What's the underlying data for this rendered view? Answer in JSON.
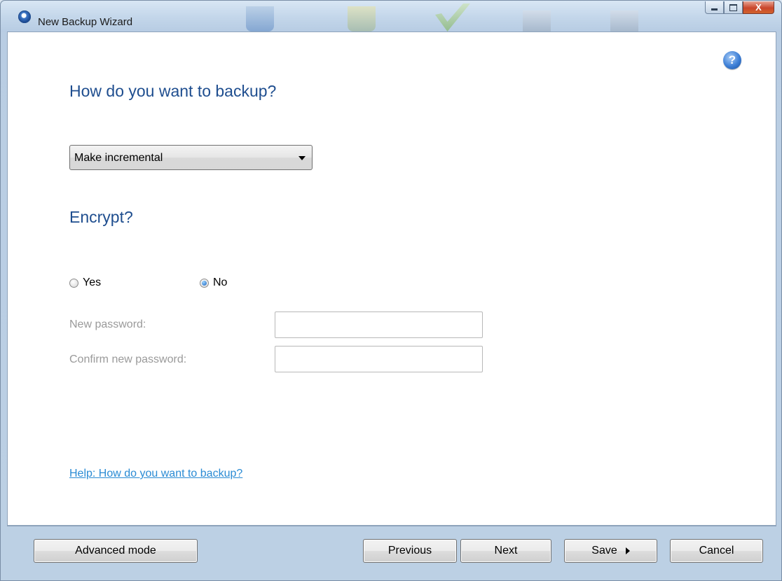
{
  "window": {
    "title": "New Backup Wizard"
  },
  "caption_buttons": {
    "close_glyph": "X"
  },
  "help": {
    "icon_glyph": "?"
  },
  "backup": {
    "heading": "How do you want to backup?",
    "mode_selected": "Make incremental"
  },
  "encrypt": {
    "heading": "Encrypt?",
    "yes_label": "Yes",
    "no_label": "No",
    "selected": "No",
    "new_password_label": "New password:",
    "new_password_value": "",
    "confirm_password_label": "Confirm new password:",
    "confirm_password_value": ""
  },
  "help_link": "Help: How do you want to backup?",
  "footer": {
    "advanced_label": "Advanced mode",
    "previous_label": "Previous",
    "next_label": "Next",
    "save_label": "Save",
    "cancel_label": "Cancel"
  },
  "colors": {
    "heading": "#1f4e8f",
    "link": "#2a8bd4",
    "disabled_text": "#9a9a9a"
  }
}
